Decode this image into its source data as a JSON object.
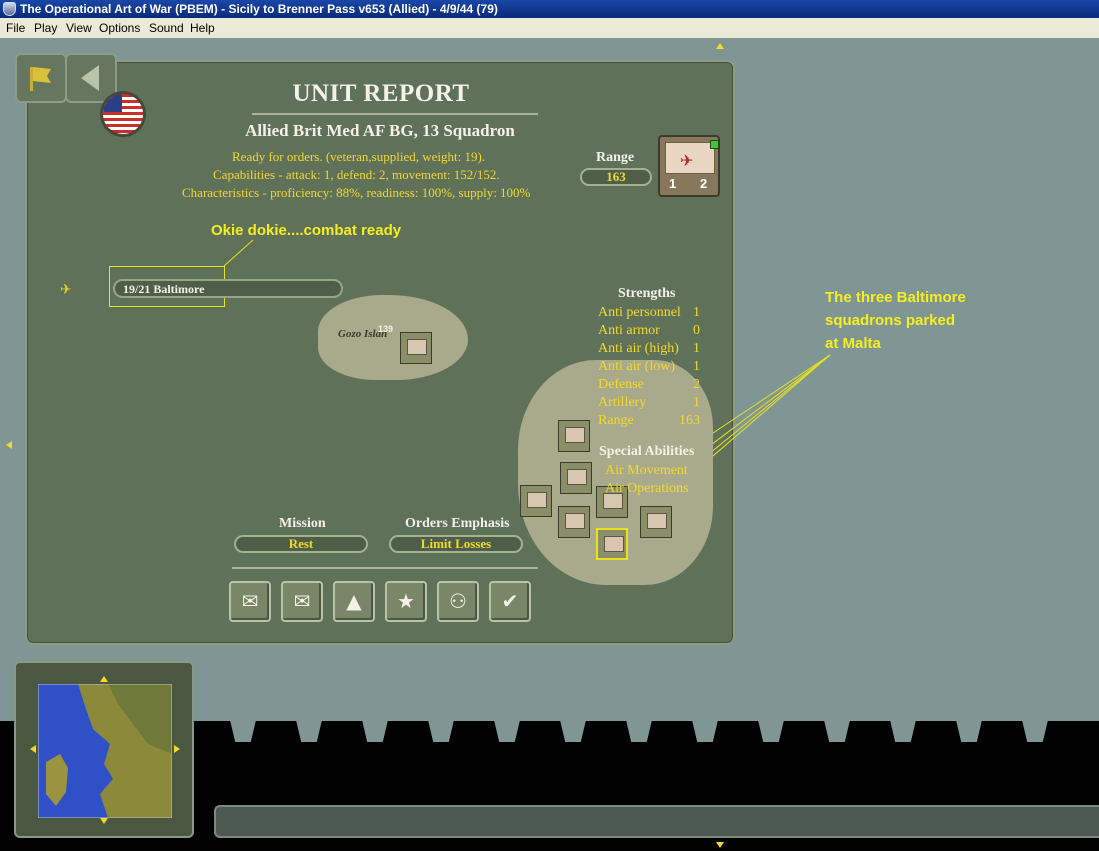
{
  "window": {
    "title": "The Operational Art of War (PBEM) - Sicily to Brenner Pass v653 (Allied) - 4/9/44 (79)"
  },
  "menu": [
    "File",
    "Play",
    "View",
    "Options",
    "Sound",
    "Help"
  ],
  "report": {
    "heading": "UNIT REPORT",
    "unit_name": "Allied Brit Med AF BG, 13 Squadron",
    "status_line": "Ready for orders. (veteran,supplied, weight: 19).",
    "capabilities_line": "Capabilities - attack: 1, defend: 2, movement: 152/152.",
    "characteristics_line": "Characteristics - proficiency: 88%, readiness: 100%, supply: 100%",
    "range_label": "Range",
    "range_value": "163",
    "counter_left": "1",
    "counter_right": "2",
    "equipment": "19/21 Baltimore",
    "strengths_title": "Strengths",
    "strengths": [
      {
        "label": "Anti personnel",
        "value": "1"
      },
      {
        "label": "Anti armor",
        "value": "0"
      },
      {
        "label": "Anti air (high)",
        "value": "1"
      },
      {
        "label": "Anti air (low)",
        "value": "1"
      },
      {
        "label": "Defense",
        "value": "2"
      },
      {
        "label": "Artillery",
        "value": "1"
      },
      {
        "label": "Range",
        "value": "163"
      }
    ],
    "special_title": "Special Abilities",
    "special": [
      "Air Movement",
      "Air Operations"
    ],
    "mission_label": "Mission",
    "mission_value": "Rest",
    "orders_label": "Orders Emphasis",
    "orders_value": "Limit Losses",
    "map_place": "Gozo Islan",
    "map_hex_number": "139"
  },
  "annotations": {
    "combat_ready": "Okie dokie....combat ready",
    "baltimore_1": "The three Baltimore",
    "baltimore_2": "squadrons parked",
    "baltimore_3": "at Malta"
  },
  "icons": {
    "nav_flag": "flag-icon",
    "nav_back": "back-arrow-icon",
    "actions": [
      "envelope-open-icon",
      "envelope-send-icon",
      "shapes-icon",
      "star-icon",
      "hierarchy-icon",
      "checkmark-icon"
    ]
  },
  "colors": {
    "panel": "#5f7159",
    "map_sea": "#7f9694",
    "text_yellow": "#f2d92c",
    "annotation": "#f6ee1e"
  }
}
